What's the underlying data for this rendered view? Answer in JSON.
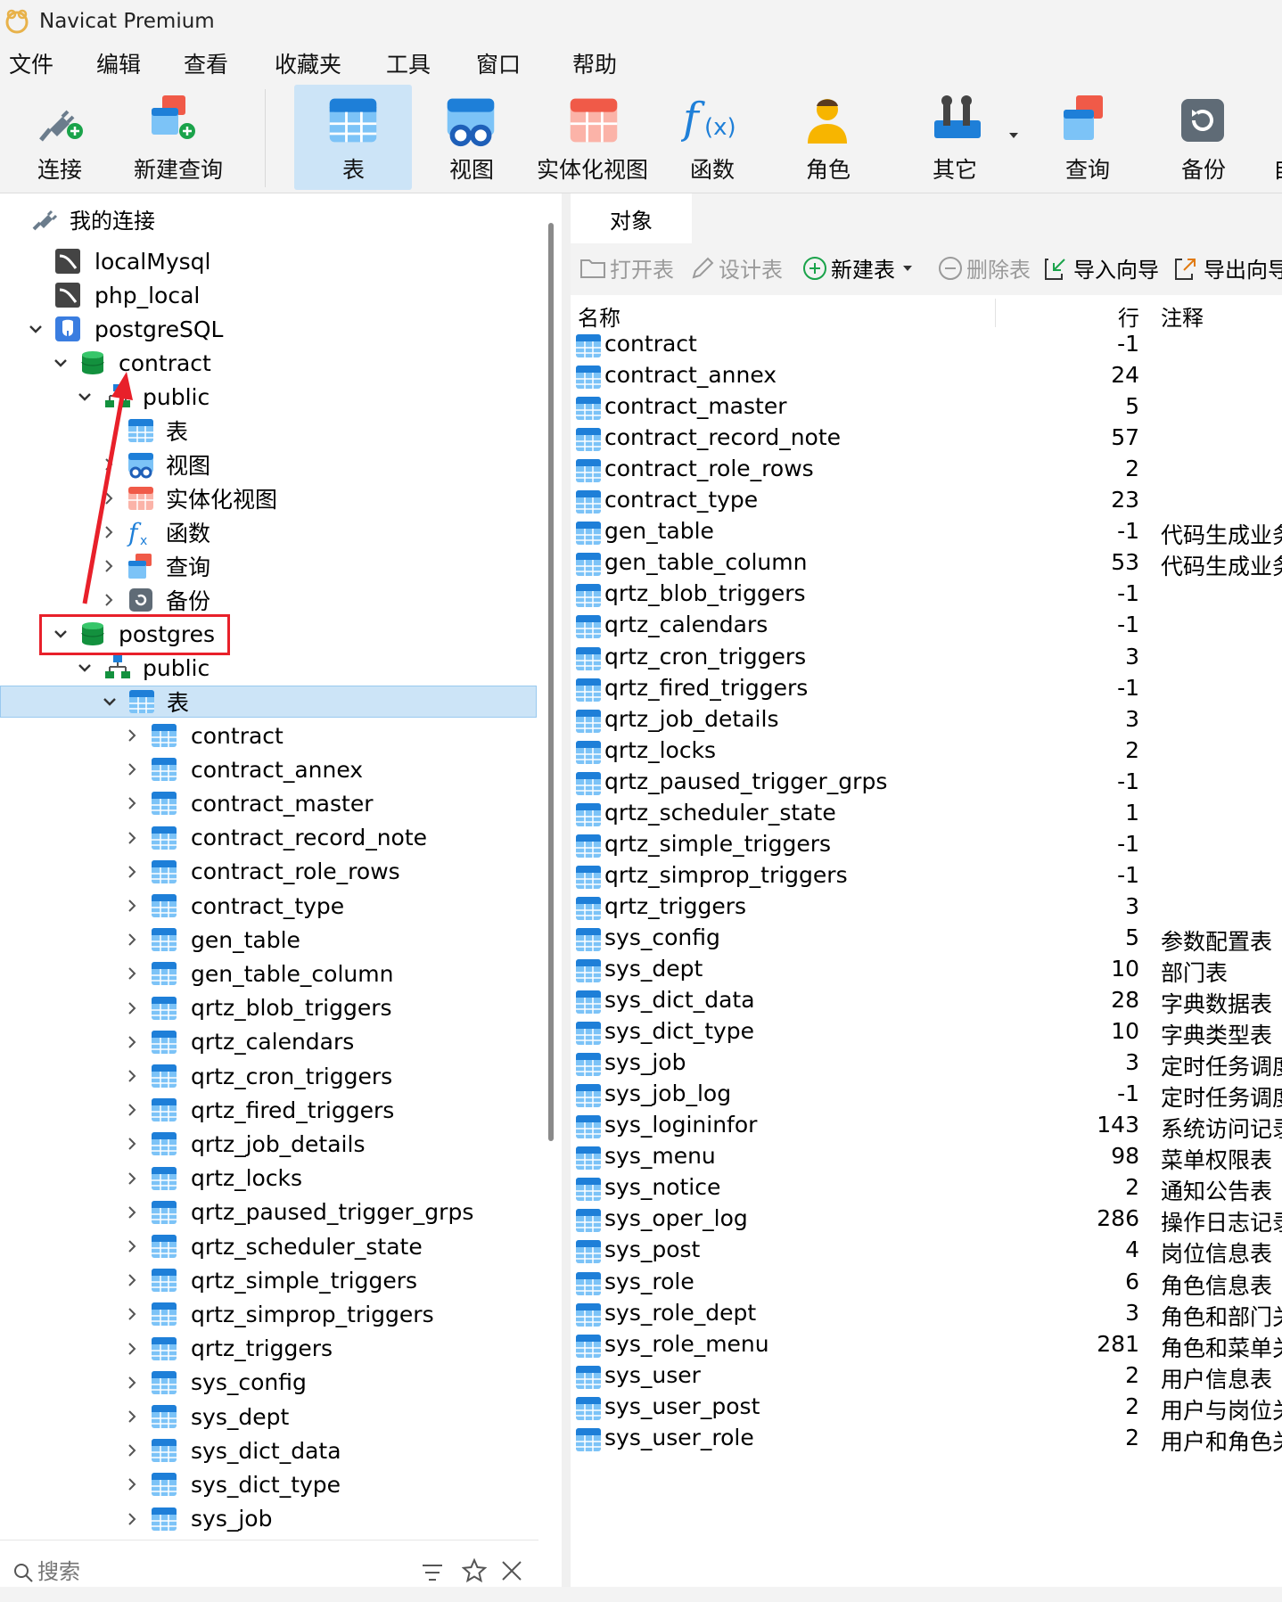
{
  "window": {
    "title": "Navicat Premium"
  },
  "menu": [
    "文件",
    "编辑",
    "查看",
    "收藏夹",
    "工具",
    "窗口",
    "帮助"
  ],
  "toolbar": {
    "connect": "连接",
    "new_query": "新建查询",
    "table": "表",
    "view": "视图",
    "mat_view": "实体化视图",
    "function": "函数",
    "role": "角色",
    "other": "其它",
    "query": "查询",
    "backup": "备份",
    "overflow": "自"
  },
  "tree": {
    "root": "我的连接",
    "conn_localmysql": "localMysql",
    "conn_php": "php_local",
    "conn_pg": "postgreSQL",
    "db_contract": "contract",
    "schema1": "public",
    "n_table": "表",
    "n_view": "视图",
    "n_matview": "实体化视图",
    "n_func": "函数",
    "n_query": "查询",
    "n_backup": "备份",
    "db_postgres": "postgres",
    "schema2": "public",
    "n_table2": "表",
    "tables": [
      "contract",
      "contract_annex",
      "contract_master",
      "contract_record_note",
      "contract_role_rows",
      "contract_type",
      "gen_table",
      "gen_table_column",
      "qrtz_blob_triggers",
      "qrtz_calendars",
      "qrtz_cron_triggers",
      "qrtz_fired_triggers",
      "qrtz_job_details",
      "qrtz_locks",
      "qrtz_paused_trigger_grps",
      "qrtz_scheduler_state",
      "qrtz_simple_triggers",
      "qrtz_simprop_triggers",
      "qrtz_triggers",
      "sys_config",
      "sys_dept",
      "sys_dict_data",
      "sys_dict_type",
      "sys_job"
    ]
  },
  "search": {
    "placeholder": "搜索"
  },
  "tab": {
    "objects": "对象"
  },
  "objtool": {
    "open": "打开表",
    "design": "设计表",
    "new": "新建表",
    "delete": "删除表",
    "import": "导入向导",
    "export": "导出向导"
  },
  "columns": {
    "name": "名称",
    "rows": "行",
    "comment": "注释"
  },
  "objects": [
    {
      "name": "contract",
      "rows": "-1",
      "comment": ""
    },
    {
      "name": "contract_annex",
      "rows": "24",
      "comment": ""
    },
    {
      "name": "contract_master",
      "rows": "5",
      "comment": ""
    },
    {
      "name": "contract_record_note",
      "rows": "57",
      "comment": ""
    },
    {
      "name": "contract_role_rows",
      "rows": "2",
      "comment": ""
    },
    {
      "name": "contract_type",
      "rows": "23",
      "comment": ""
    },
    {
      "name": "gen_table",
      "rows": "-1",
      "comment": "代码生成业务"
    },
    {
      "name": "gen_table_column",
      "rows": "53",
      "comment": "代码生成业务"
    },
    {
      "name": "qrtz_blob_triggers",
      "rows": "-1",
      "comment": ""
    },
    {
      "name": "qrtz_calendars",
      "rows": "-1",
      "comment": ""
    },
    {
      "name": "qrtz_cron_triggers",
      "rows": "3",
      "comment": ""
    },
    {
      "name": "qrtz_fired_triggers",
      "rows": "-1",
      "comment": ""
    },
    {
      "name": "qrtz_job_details",
      "rows": "3",
      "comment": ""
    },
    {
      "name": "qrtz_locks",
      "rows": "2",
      "comment": ""
    },
    {
      "name": "qrtz_paused_trigger_grps",
      "rows": "-1",
      "comment": ""
    },
    {
      "name": "qrtz_scheduler_state",
      "rows": "1",
      "comment": ""
    },
    {
      "name": "qrtz_simple_triggers",
      "rows": "-1",
      "comment": ""
    },
    {
      "name": "qrtz_simprop_triggers",
      "rows": "-1",
      "comment": ""
    },
    {
      "name": "qrtz_triggers",
      "rows": "3",
      "comment": ""
    },
    {
      "name": "sys_config",
      "rows": "5",
      "comment": "参数配置表"
    },
    {
      "name": "sys_dept",
      "rows": "10",
      "comment": "部门表"
    },
    {
      "name": "sys_dict_data",
      "rows": "28",
      "comment": "字典数据表"
    },
    {
      "name": "sys_dict_type",
      "rows": "10",
      "comment": "字典类型表"
    },
    {
      "name": "sys_job",
      "rows": "3",
      "comment": "定时任务调度"
    },
    {
      "name": "sys_job_log",
      "rows": "-1",
      "comment": "定时任务调度"
    },
    {
      "name": "sys_logininfor",
      "rows": "143",
      "comment": "系统访问记录"
    },
    {
      "name": "sys_menu",
      "rows": "98",
      "comment": "菜单权限表"
    },
    {
      "name": "sys_notice",
      "rows": "2",
      "comment": "通知公告表"
    },
    {
      "name": "sys_oper_log",
      "rows": "286",
      "comment": "操作日志记录"
    },
    {
      "name": "sys_post",
      "rows": "4",
      "comment": "岗位信息表"
    },
    {
      "name": "sys_role",
      "rows": "6",
      "comment": "角色信息表"
    },
    {
      "name": "sys_role_dept",
      "rows": "3",
      "comment": "角色和部门关"
    },
    {
      "name": "sys_role_menu",
      "rows": "281",
      "comment": "角色和菜单关"
    },
    {
      "name": "sys_user",
      "rows": "2",
      "comment": "用户信息表"
    },
    {
      "name": "sys_user_post",
      "rows": "2",
      "comment": "用户与岗位关"
    },
    {
      "name": "sys_user_role",
      "rows": "2",
      "comment": "用户和角色关"
    }
  ],
  "colors": {
    "accent": "#1e7fd8",
    "selection": "#cce4f7",
    "annotation_red": "#e8202a",
    "db_green": "#1aa34a"
  }
}
